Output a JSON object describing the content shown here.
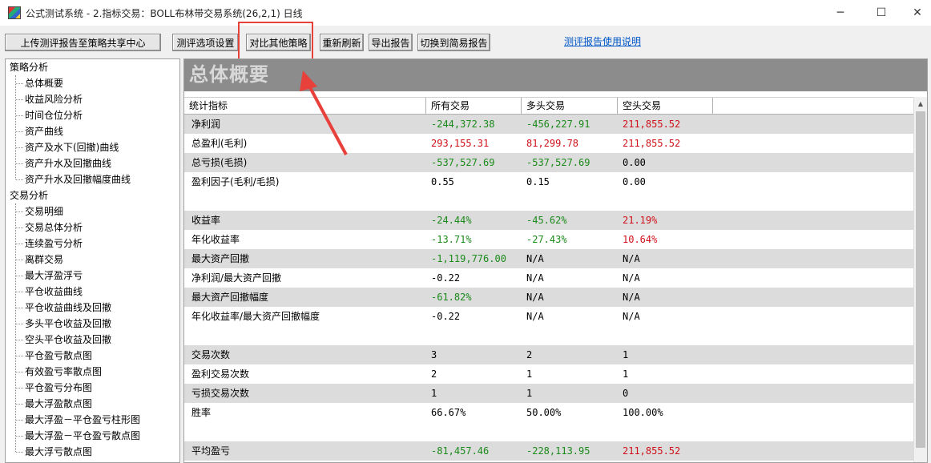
{
  "window": {
    "title": "公式测试系统 - 2.指标交易：BOLL布林带交易系统(26,2,1) 日线",
    "min": "─",
    "max": "☐",
    "close": "✕"
  },
  "toolbar": {
    "upload": "上传测评报告至策略共享中心",
    "options": "测评选项设置",
    "compare": "对比其他策略",
    "refresh": "重新刷新",
    "export": "导出报告",
    "simple": "切换到简易报告",
    "help_link": "测评报告使用说明"
  },
  "sidebar": {
    "groups": [
      {
        "label": "策略分析",
        "items": [
          "总体概要",
          "收益风险分析",
          "时间仓位分析",
          "资产曲线",
          "资产及水下(回撤)曲线",
          "资产升水及回撤曲线",
          "资产升水及回撤幅度曲线"
        ]
      },
      {
        "label": "交易分析",
        "items": [
          "交易明细",
          "交易总体分析",
          "连续盈亏分析",
          "离群交易",
          "最大浮盈浮亏",
          "平仓收益曲线",
          "平仓收益曲线及回撤",
          "多头平仓收益及回撤",
          "空头平仓收益及回撤",
          "平仓盈亏散点图",
          "有效盈亏率散点图",
          "平仓盈亏分布图",
          "最大浮盈散点图",
          "最大浮盈－平仓盈亏柱形图",
          "最大浮盈－平仓盈亏散点图",
          "最大浮亏散点图"
        ]
      }
    ]
  },
  "main": {
    "banner": "总体概要",
    "headers": [
      "统计指标",
      "所有交易",
      "多头交易",
      "空头交易"
    ],
    "rows": [
      {
        "label": "净利润",
        "v": [
          "-244,372.38",
          "-456,227.91",
          "211,855.52"
        ],
        "c": [
          "g",
          "g",
          "r"
        ],
        "shade": true
      },
      {
        "label": "总盈利(毛利)",
        "v": [
          "293,155.31",
          "81,299.78",
          "211,855.52"
        ],
        "c": [
          "r",
          "r",
          "r"
        ],
        "shade": false
      },
      {
        "label": "总亏损(毛损)",
        "v": [
          "-537,527.69",
          "-537,527.69",
          "0.00"
        ],
        "c": [
          "g",
          "g",
          "k"
        ],
        "shade": true
      },
      {
        "label": "盈利因子(毛利/毛损)",
        "v": [
          "0.55",
          "0.15",
          "0.00"
        ],
        "c": [
          "k",
          "k",
          "k"
        ],
        "shade": false
      },
      {
        "label": "",
        "v": [
          "",
          "",
          ""
        ],
        "c": [
          "k",
          "k",
          "k"
        ],
        "shade": false
      },
      {
        "label": "收益率",
        "v": [
          "-24.44%",
          "-45.62%",
          "21.19%"
        ],
        "c": [
          "g",
          "g",
          "r"
        ],
        "shade": true
      },
      {
        "label": "年化收益率",
        "v": [
          "-13.71%",
          "-27.43%",
          "10.64%"
        ],
        "c": [
          "g",
          "g",
          "r"
        ],
        "shade": false
      },
      {
        "label": "最大资产回撤",
        "v": [
          "-1,119,776.00",
          "N/A",
          "N/A"
        ],
        "c": [
          "g",
          "k",
          "k"
        ],
        "shade": true
      },
      {
        "label": "净利润/最大资产回撤",
        "v": [
          "-0.22",
          "N/A",
          "N/A"
        ],
        "c": [
          "k",
          "k",
          "k"
        ],
        "shade": false
      },
      {
        "label": "最大资产回撤幅度",
        "v": [
          "-61.82%",
          "N/A",
          "N/A"
        ],
        "c": [
          "g",
          "k",
          "k"
        ],
        "shade": true
      },
      {
        "label": "年化收益率/最大资产回撤幅度",
        "v": [
          "-0.22",
          "N/A",
          "N/A"
        ],
        "c": [
          "k",
          "k",
          "k"
        ],
        "shade": false
      },
      {
        "label": "",
        "v": [
          "",
          "",
          ""
        ],
        "c": [
          "k",
          "k",
          "k"
        ],
        "shade": false
      },
      {
        "label": "交易次数",
        "v": [
          "3",
          "2",
          "1"
        ],
        "c": [
          "k",
          "k",
          "k"
        ],
        "shade": true
      },
      {
        "label": "盈利交易次数",
        "v": [
          "2",
          "1",
          "1"
        ],
        "c": [
          "k",
          "k",
          "k"
        ],
        "shade": false
      },
      {
        "label": "亏损交易次数",
        "v": [
          "1",
          "1",
          "0"
        ],
        "c": [
          "k",
          "k",
          "k"
        ],
        "shade": true
      },
      {
        "label": "胜率",
        "v": [
          "66.67%",
          "50.00%",
          "100.00%"
        ],
        "c": [
          "k",
          "k",
          "k"
        ],
        "shade": false
      },
      {
        "label": "",
        "v": [
          "",
          "",
          ""
        ],
        "c": [
          "k",
          "k",
          "k"
        ],
        "shade": false
      },
      {
        "label": "平均盈亏",
        "v": [
          "-81,457.46",
          "-228,113.95",
          "211,855.52"
        ],
        "c": [
          "g",
          "g",
          "r"
        ],
        "shade": true
      }
    ]
  },
  "colors": {
    "accent_red": "#e8413c",
    "link_blue": "#0057c8",
    "positive": "#d0101a",
    "negative": "#1a8a1a"
  }
}
